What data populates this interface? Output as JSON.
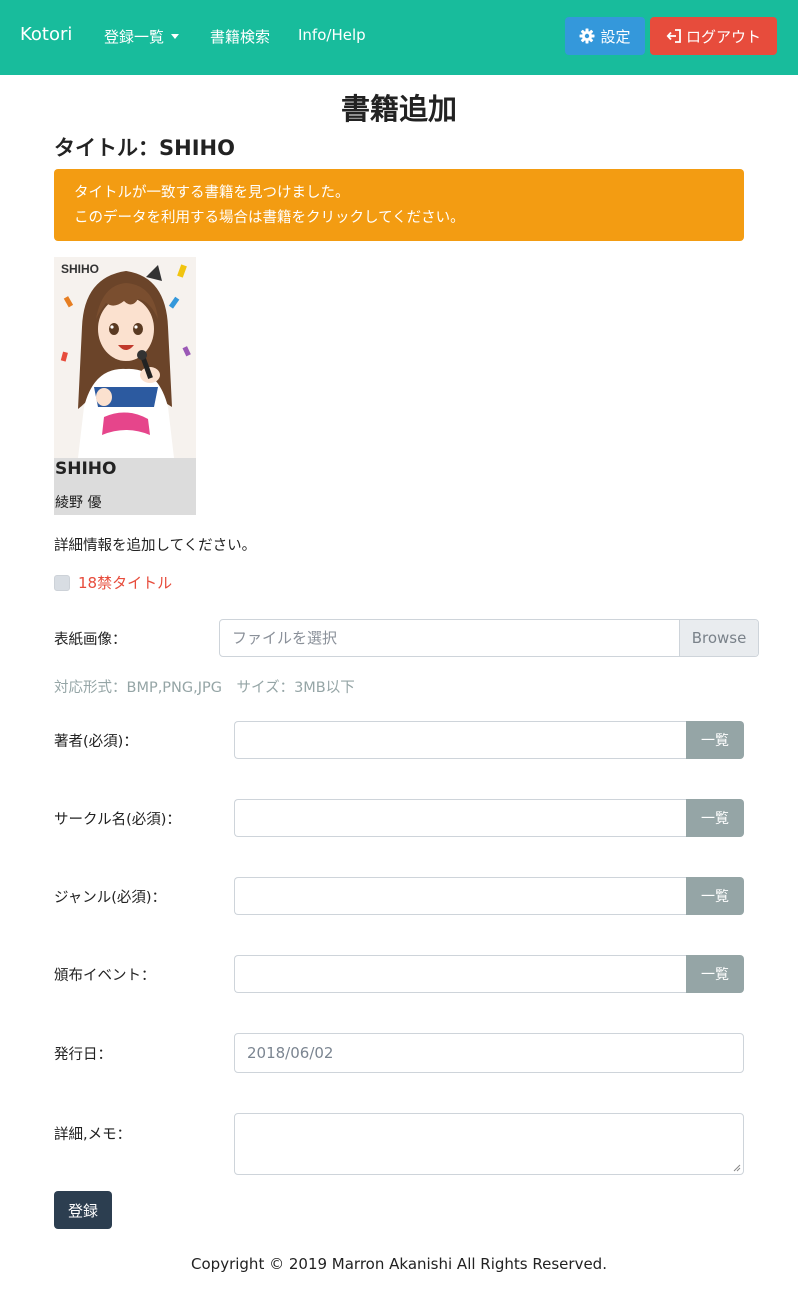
{
  "navbar": {
    "brand": "Kotori",
    "links": [
      "登録一覧",
      "書籍検索",
      "Info/Help"
    ],
    "settings_label": "設定",
    "logout_label": "ログアウト",
    "colors": {
      "navbar": "#18bc9c",
      "settings": "#3498db",
      "logout": "#e74c3c"
    }
  },
  "page": {
    "title": "書籍追加",
    "book_title_label": "タイトル：",
    "book_title_value": "SHIHO"
  },
  "alert": {
    "line1": "タイトルが一致する書籍を見つけました。",
    "line2": "このデータを利用する場合は書籍をクリックしてください。",
    "color": "#f39c12"
  },
  "book_card": {
    "cover_label": "SHIHO",
    "title": "SHIHO",
    "author": "綾野 優"
  },
  "form": {
    "hint": "詳細情報を追加してください。",
    "adult_label": "18禁タイトル",
    "cover_label": "表紙画像：",
    "file_placeholder": "ファイルを選択",
    "browse_label": "Browse",
    "file_help": "対応形式：BMP,PNG,JPG　サイズ：3MB以下",
    "author_label": "著者(必須)：",
    "circle_label": "サークル名(必須)：",
    "genre_label": "ジャンル(必須)：",
    "event_label": "頒布イベント：",
    "list_button": "一覧",
    "date_label": "発行日：",
    "date_value": "2018/06/02",
    "memo_label": "詳細,メモ：",
    "submit_label": "登録"
  },
  "footer": {
    "copyright": "Copyright © 2019 Marron Akanishi All Rights Reserved."
  }
}
